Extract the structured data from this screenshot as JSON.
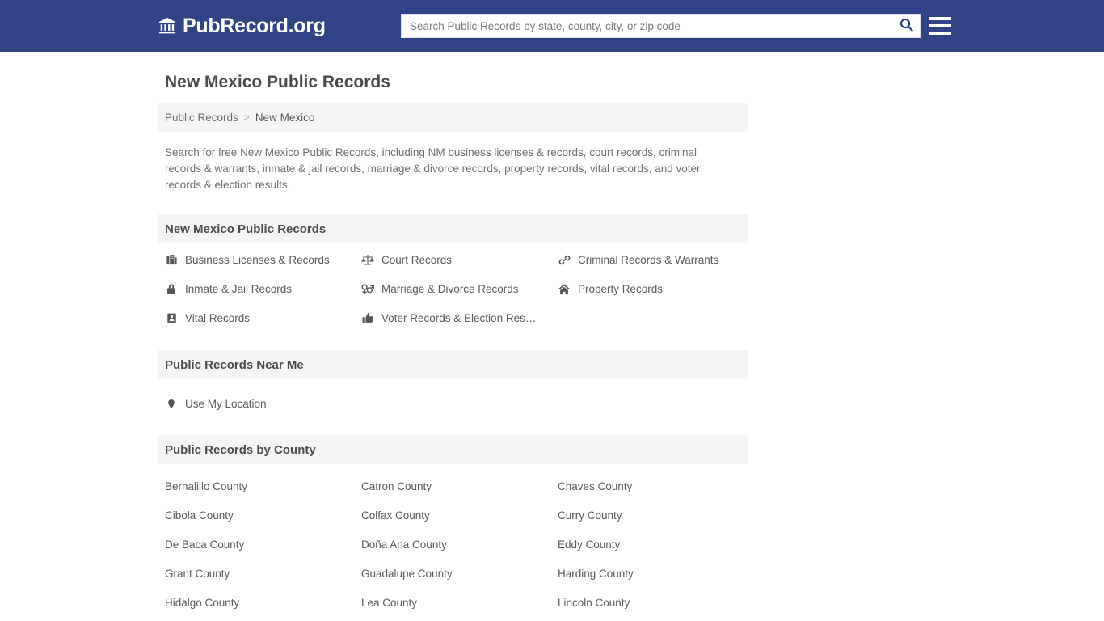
{
  "header": {
    "brand_name": "PubRecord.org",
    "brand_icon": "bank-building-icon",
    "search": {
      "placeholder": "Search Public Records by state, county, city, or zip code",
      "value": "",
      "button_icon": "search-icon"
    },
    "menu_icon": "hamburger-menu-icon",
    "background_color": "#2e4487"
  },
  "page": {
    "title": "New Mexico Public Records",
    "intro": "Search for free New Mexico Public Records, including NM business licenses & records, court records, criminal records & warrants, inmate & jail records, marriage & divorce records, property records, vital records, and voter records & election results."
  },
  "breadcrumb": {
    "root": "Public Records",
    "separator": ">",
    "current": "New Mexico"
  },
  "records_section": {
    "heading": "New Mexico Public Records",
    "items": [
      {
        "label": "Business Licenses & Records",
        "icon": "business-building-icon"
      },
      {
        "label": "Court Records",
        "icon": "scales-of-justice-icon"
      },
      {
        "label": "Criminal Records & Warrants",
        "icon": "chain-link-icon"
      },
      {
        "label": "Inmate & Jail Records",
        "icon": "lock-icon"
      },
      {
        "label": "Marriage & Divorce Records",
        "icon": "venus-mars-icon"
      },
      {
        "label": "Property Records",
        "icon": "home-icon"
      },
      {
        "label": "Vital Records",
        "icon": "id-card-icon"
      },
      {
        "label": "Voter Records & Election Res…",
        "icon": "thumbs-up-icon"
      }
    ]
  },
  "near_me_section": {
    "heading": "Public Records Near Me",
    "items": [
      {
        "label": "Use My Location",
        "icon": "map-pin-icon"
      }
    ]
  },
  "county_section": {
    "heading": "Public Records by County",
    "counties": [
      "Bernalillo County",
      "Catron County",
      "Chaves County",
      "Cibola County",
      "Colfax County",
      "Curry County",
      "De Baca County",
      "Doña Ana County",
      "Eddy County",
      "Grant County",
      "Guadalupe County",
      "Harding County",
      "Hidalgo County",
      "Lea County",
      "Lincoln County"
    ]
  }
}
